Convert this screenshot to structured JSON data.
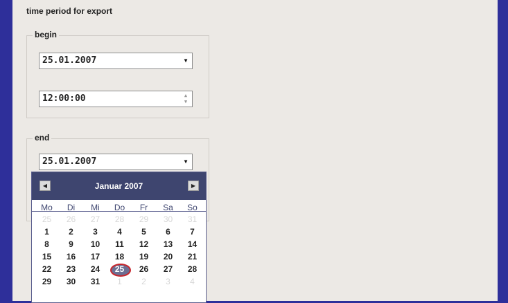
{
  "section": {
    "title": "time period for export"
  },
  "begin": {
    "label": "begin",
    "date": "25.01.2007",
    "time": "12:00:00"
  },
  "end": {
    "label": "end",
    "date": "25.01.2007"
  },
  "calendar": {
    "title": "Januar 2007",
    "prev": "◀",
    "next": "▶",
    "weekdays": [
      "Mo",
      "Di",
      "Mi",
      "Do",
      "Fr",
      "Sa",
      "So"
    ],
    "weeks": [
      [
        "25",
        "26",
        "27",
        "28",
        "29",
        "30",
        "31"
      ],
      [
        "1",
        "2",
        "3",
        "4",
        "5",
        "6",
        "7"
      ],
      [
        "8",
        "9",
        "10",
        "11",
        "12",
        "13",
        "14"
      ],
      [
        "15",
        "16",
        "17",
        "18",
        "19",
        "20",
        "21"
      ],
      [
        "22",
        "23",
        "24",
        "25",
        "26",
        "27",
        "28"
      ],
      [
        "29",
        "30",
        "31",
        "1",
        "2",
        "3",
        "4"
      ]
    ],
    "selected_day": "25"
  },
  "colors": {
    "background": "#2e2f9a",
    "panel": "#ece9e5",
    "calendar_header": "#3e456f",
    "selection_ring": "#c8252b"
  },
  "icons": {
    "dropdown": "chevron-down-icon",
    "spinner": "spinner-icon",
    "prev": "arrow-left-icon",
    "next": "arrow-right-icon"
  }
}
